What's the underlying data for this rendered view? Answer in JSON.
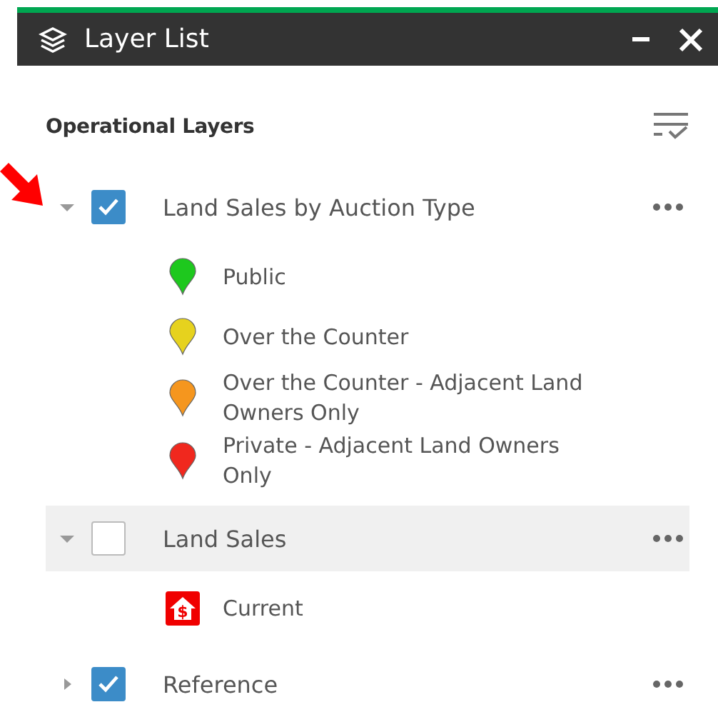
{
  "window": {
    "title": "Layer List"
  },
  "section": {
    "title": "Operational Layers"
  },
  "layers": [
    {
      "label": "Land Sales by Auction Type",
      "expanded": true,
      "checked": true,
      "highlighted": false,
      "legend": [
        {
          "kind": "pin",
          "label": "Public",
          "color": "#1ec81e"
        },
        {
          "kind": "pin",
          "label": "Over the Counter",
          "color": "#e6d21e"
        },
        {
          "kind": "pin",
          "label": "Over the Counter - Adjacent Land Owners Only",
          "color": "#f5961e"
        },
        {
          "kind": "pin",
          "label": "Private - Adjacent Land Owners Only",
          "color": "#f0281e"
        }
      ]
    },
    {
      "label": "Land Sales",
      "expanded": true,
      "checked": false,
      "highlighted": true,
      "legend": [
        {
          "kind": "house",
          "label": "Current",
          "symbol": "$",
          "color": "#f00000"
        }
      ]
    },
    {
      "label": "Reference",
      "expanded": false,
      "checked": true,
      "highlighted": false
    }
  ]
}
